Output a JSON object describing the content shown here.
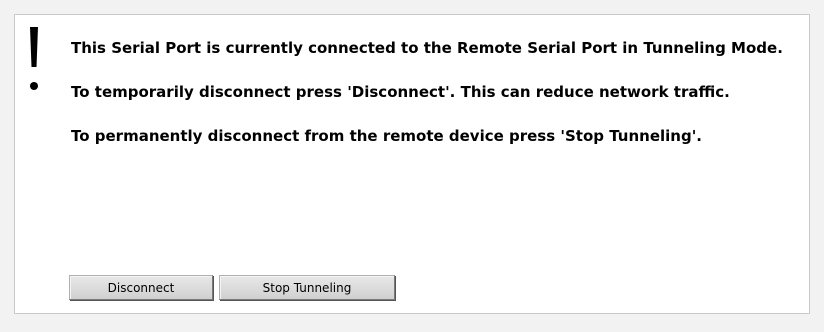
{
  "notice": {
    "icon": "exclamation-icon",
    "paragraphs": [
      "This Serial Port is currently connected to the Remote Serial Port in Tunneling Mode.",
      "To temporarily disconnect press 'Disconnect'. This can reduce network traffic.",
      "To permanently disconnect from the remote device press 'Stop Tunneling'."
    ]
  },
  "buttons": {
    "disconnect": "Disconnect",
    "stop_tunneling": "Stop Tunneling"
  },
  "colors": {
    "panel_background": "#ffffff",
    "page_background": "#f2f2f2",
    "button_background": "#d8d8d8"
  }
}
